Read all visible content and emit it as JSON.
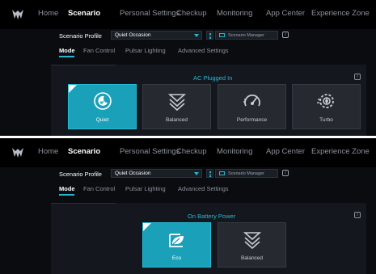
{
  "nav": {
    "items": [
      "Home",
      "Scenario",
      "Personal Settings",
      "Checkup",
      "Monitoring",
      "App Center",
      "Experience Zone"
    ],
    "active": "Scenario"
  },
  "profile": {
    "label": "Scenario Profile",
    "selected": "Quiet Occasion",
    "manager_label": "Scenario Manager"
  },
  "subtabs": {
    "items": [
      "Mode",
      "Fan Control",
      "Pulsar Lighting",
      "Advanced Settings"
    ],
    "active": "Mode"
  },
  "panels": [
    {
      "power_state": "AC Plugged In",
      "modes": [
        {
          "label": "Quiet",
          "icon": "moon-icon",
          "selected": true
        },
        {
          "label": "Balanced",
          "icon": "balanced-chevrons-icon",
          "selected": false
        },
        {
          "label": "Performance",
          "icon": "speedometer-icon",
          "selected": false
        },
        {
          "label": "Turbo",
          "icon": "turbo-fan-icon",
          "selected": false
        }
      ]
    },
    {
      "power_state": "On Battery Power",
      "modes": [
        {
          "label": "Eco",
          "icon": "eco-battery-leaf-icon",
          "selected": true
        },
        {
          "label": "Balanced",
          "icon": "balanced-chevrons-icon",
          "selected": false
        }
      ]
    }
  ],
  "colors": {
    "accent": "#27b6cf",
    "selected_card": "#1aa0b8",
    "card": "#262a30",
    "background": "#0a0c10"
  }
}
